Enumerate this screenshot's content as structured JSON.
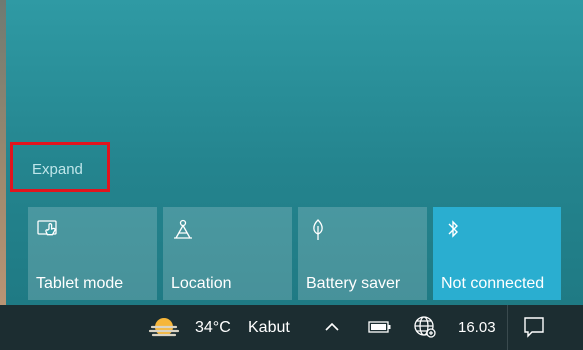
{
  "action_center": {
    "expand_label": "Expand",
    "tiles": [
      {
        "label": "Tablet mode",
        "icon": "tablet-mode-icon",
        "active": false
      },
      {
        "label": "Location",
        "icon": "location-icon",
        "active": false
      },
      {
        "label": "Battery saver",
        "icon": "battery-saver-icon",
        "active": false
      },
      {
        "label": "Not connected",
        "icon": "bluetooth-icon",
        "active": true
      }
    ]
  },
  "taskbar": {
    "temperature": "34°C",
    "condition": "Kabut",
    "time": "16.03",
    "icons": [
      "weather-haze-icon",
      "chevron-up-icon",
      "battery-icon",
      "network-globe-icon",
      "notification-icon"
    ]
  },
  "colors": {
    "accent": "#2aaed0",
    "highlight": "#e0141e",
    "panel": "#24848e",
    "taskbar": "#1c2d31"
  }
}
